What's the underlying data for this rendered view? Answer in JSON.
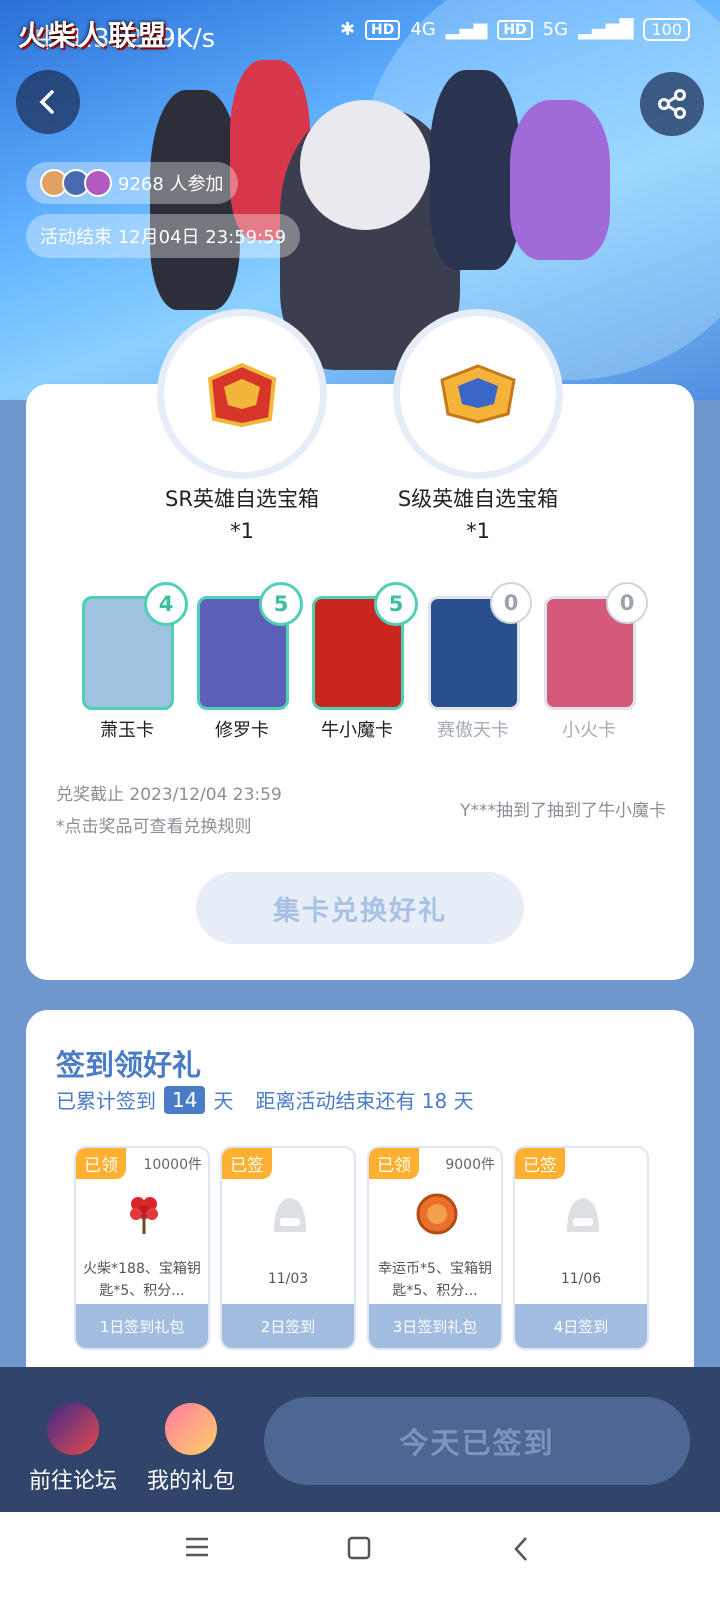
{
  "status_bar": {
    "left": "中 1.31209K/s",
    "icons": [
      "moon-icon",
      "bell-off-icon"
    ],
    "net1": "HD",
    "net1_type": "4G",
    "net2": "HD",
    "net2_type": "5G",
    "battery": "100"
  },
  "banner": {
    "logo": "火柴人联盟",
    "participants": "9268 人参加",
    "end_time": "活动结束 12月04日 23:59:59"
  },
  "chests": [
    {
      "name": "SR英雄自选宝箱",
      "qty": "*1",
      "color": "#e0332c"
    },
    {
      "name": "S级英雄自选宝箱",
      "qty": "*1",
      "color": "#f2a62a"
    }
  ],
  "hero_cards": [
    {
      "name": "萧玉卡",
      "count": "4",
      "owned": true,
      "bg": "#9ec2e0"
    },
    {
      "name": "修罗卡",
      "count": "5",
      "owned": true,
      "bg": "#5b5fb8"
    },
    {
      "name": "牛小魔卡",
      "count": "5",
      "owned": true,
      "bg": "#c8261e"
    },
    {
      "name": "赛傲天卡",
      "count": "0",
      "owned": false,
      "bg": "#2a4f8e"
    },
    {
      "name": "小火卡",
      "count": "0",
      "owned": false,
      "bg": "#d45a7a"
    }
  ],
  "exchange": {
    "deadline": "兑奖截止 2023/12/04 23:59",
    "rule_hint": "*点击奖品可查看兑换规则",
    "marquee": "Y***抽到了抽到了牛小魔卡",
    "button": "集卡兑换好礼"
  },
  "sign": {
    "title": "签到领好礼",
    "prefix": "已累计签到",
    "days": "14",
    "days_unit": "天",
    "remain": "距离活动结束还有 18 天",
    "gifts": [
      {
        "tag": "已领",
        "count": "10000件",
        "desc": "火柴*188、宝箱钥匙*5、积分...",
        "foot": "1日签到礼包",
        "icon": "red-flower-icon"
      },
      {
        "tag": "已签",
        "count": "",
        "desc": "11/03",
        "foot": "2日签到",
        "icon": "placeholder-avatar-icon"
      },
      {
        "tag": "已领",
        "count": "9000件",
        "desc": "幸运币*5、宝箱钥匙*5、积分...",
        "foot": "3日签到礼包",
        "icon": "lucky-coin-icon"
      },
      {
        "tag": "已签",
        "count": "",
        "desc": "11/06",
        "foot": "4日签到",
        "icon": "placeholder-avatar-icon"
      }
    ]
  },
  "bottom_bar": {
    "forum": "前往论坛",
    "gifts": "我的礼包",
    "signed": "今天已签到"
  }
}
